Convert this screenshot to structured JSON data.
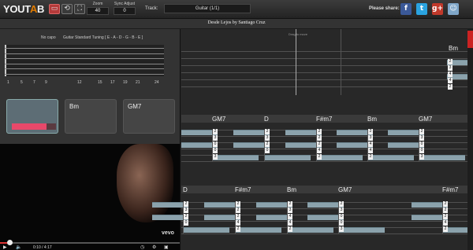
{
  "app": {
    "logo_left": "YOUT",
    "logo_accent": "A",
    "logo_right": "B"
  },
  "toolbar": {
    "zoom_label": "Zoom",
    "zoom_value": "40",
    "sync_label": "Sync Adjust",
    "sync_value": "0",
    "track_label": "Track:",
    "track_value": "Guitar (1/1)",
    "share_label": "Please share:"
  },
  "social": [
    {
      "label": "f",
      "name": "facebook-icon",
      "color": "#3b5998"
    },
    {
      "label": "t",
      "name": "twitter-icon",
      "color": "#2aa3e0"
    },
    {
      "label": "g+",
      "name": "google-plus-icon",
      "color": "#c0392b"
    },
    {
      "label": "☺",
      "name": "reddit-icon",
      "color": "#7fa6c8"
    }
  ],
  "song": {
    "title": "Desde Lejos by Santiago Cruz"
  },
  "fretboard": {
    "capo": "No capo",
    "tuning": "Guitar Standard Tuning [ E - A - D - G - B - E ]",
    "fret_numbers": [
      "1",
      "5",
      "7",
      "9",
      "12",
      "15",
      "17",
      "19",
      "21",
      "24"
    ]
  },
  "chords_panel": [
    {
      "name": "",
      "selected": true,
      "progress": 0.78
    },
    {
      "name": "Bm",
      "selected": false
    },
    {
      "name": "GM7",
      "selected": false
    }
  ],
  "video": {
    "brand": "vevo",
    "time_current": "0:10",
    "time_sep": "/",
    "time_total": "4:17",
    "progress": 0.05
  },
  "tab": {
    "cursor_label": "Drag to move",
    "row0": {
      "chords": [
        "Bm"
      ],
      "numbers": [
        "2",
        "3",
        "4",
        "4",
        "2"
      ]
    },
    "row1": {
      "chords": [
        "GM7",
        "D",
        "F#m7",
        "Bm",
        "GM7"
      ],
      "numbers": [
        [
          "2",
          "3",
          "0",
          "0",
          "3"
        ],
        [
          "2",
          "3",
          "2",
          "0"
        ],
        [
          "2",
          "2",
          "2",
          "4",
          "2"
        ],
        [
          "2",
          "3",
          "4",
          "4",
          "2"
        ],
        [
          "2",
          "3",
          "0",
          "0",
          "3"
        ]
      ]
    },
    "row2": {
      "chords": [
        "D",
        "F#m7",
        "Bm",
        "GM7",
        "F#m7"
      ],
      "numbers": [
        [
          "2",
          "3",
          "2",
          "0"
        ],
        [
          "2",
          "2",
          "2",
          "4",
          "2"
        ],
        [
          "2",
          "3",
          "4",
          "4",
          "2"
        ],
        [
          "2",
          "3",
          "0",
          "0",
          "3"
        ],
        [
          "2",
          "2",
          "2",
          "4",
          "2"
        ]
      ]
    }
  }
}
